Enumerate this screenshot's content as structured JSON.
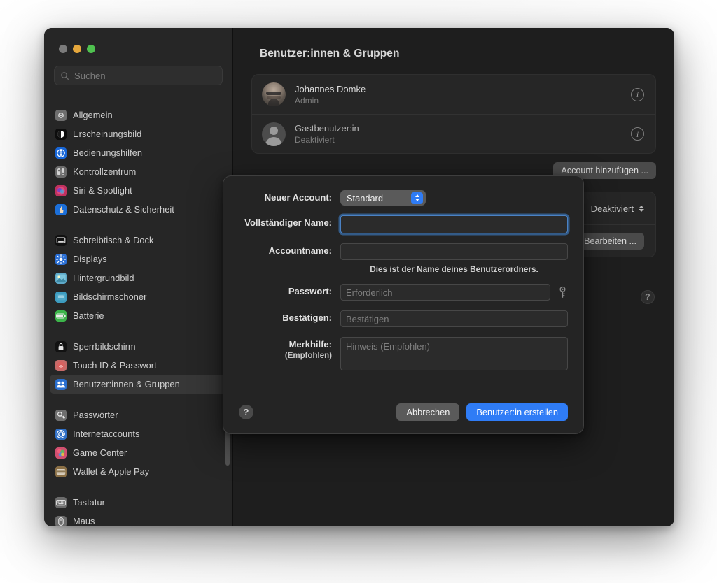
{
  "window": {
    "traffic_lights": [
      "close",
      "minimize",
      "zoom"
    ]
  },
  "sidebar": {
    "search": {
      "placeholder": "Suchen",
      "value": ""
    },
    "groups": [
      {
        "items": [
          {
            "label": "Allgemein",
            "icon": "gear-icon",
            "color": "#6e6e6e"
          },
          {
            "label": "Erscheinungsbild",
            "icon": "appearance-icon",
            "color": "#0d0d0d"
          },
          {
            "label": "Bedienungshilfen",
            "icon": "accessibility-icon",
            "color": "#1866d6"
          },
          {
            "label": "Kontrollzentrum",
            "icon": "control-center-icon",
            "color": "#6b6b6b"
          },
          {
            "label": "Siri & Spotlight",
            "icon": "siri-icon",
            "color": "#c0315f"
          },
          {
            "label": "Datenschutz & Sicherheit",
            "icon": "privacy-hand-icon",
            "color": "#1c6fd8"
          }
        ]
      },
      {
        "items": [
          {
            "label": "Schreibtisch & Dock",
            "icon": "desktop-dock-icon",
            "color": "#111111"
          },
          {
            "label": "Displays",
            "icon": "display-icon",
            "color": "#2b6fd4"
          },
          {
            "label": "Hintergrundbild",
            "icon": "wallpaper-icon",
            "color": "#5ea9c8"
          },
          {
            "label": "Bildschirmschoner",
            "icon": "screensaver-icon",
            "color": "#3c9bbf"
          },
          {
            "label": "Batterie",
            "icon": "battery-icon",
            "color": "#3cb54a"
          }
        ]
      },
      {
        "items": [
          {
            "label": "Sperrbildschirm",
            "icon": "lock-screen-icon",
            "color": "#121212"
          },
          {
            "label": "Touch ID & Passwort",
            "icon": "touch-id-icon",
            "color": "#c66a68"
          },
          {
            "label": "Benutzer:innen & Gruppen",
            "icon": "users-groups-icon",
            "color": "#2a6fd0",
            "selected": true
          }
        ]
      },
      {
        "items": [
          {
            "label": "Passwörter",
            "icon": "passwords-key-icon",
            "color": "#6f6f6f"
          },
          {
            "label": "Internetaccounts",
            "icon": "internet-accounts-icon",
            "color": "#2f6fc6"
          },
          {
            "label": "Game Center",
            "icon": "game-center-icon",
            "color": "#d14f70"
          },
          {
            "label": "Wallet & Apple Pay",
            "icon": "wallet-icon",
            "color": "#8a6f45"
          }
        ]
      },
      {
        "items": [
          {
            "label": "Tastatur",
            "icon": "keyboard-icon",
            "color": "#6b6b6b"
          },
          {
            "label": "Maus",
            "icon": "mouse-icon",
            "color": "#6b6b6b"
          }
        ]
      }
    ]
  },
  "main": {
    "title": "Benutzer:innen & Gruppen",
    "users": [
      {
        "name": "Johannes Domke",
        "role": "Admin",
        "avatar": "photo",
        "info": "i"
      },
      {
        "name": "Gastbenutzer:in",
        "role": "Deaktiviert",
        "avatar": "generic",
        "info": "i"
      }
    ],
    "add_account_button": "Account hinzufügen ...",
    "settings_rows": [
      {
        "kind": "popup",
        "value": "Deaktiviert"
      },
      {
        "kind": "button",
        "value": "Bearbeiten ..."
      }
    ],
    "help_button": "?"
  },
  "sheet": {
    "fields": {
      "new_account_label": "Neuer Account:",
      "new_account_value": "Standard",
      "full_name_label": "Vollständiger Name:",
      "full_name_value": "",
      "full_name_placeholder": "",
      "account_name_label": "Accountname:",
      "account_name_value": "",
      "account_name_placeholder": "",
      "account_name_hint": "Dies ist der Name deines Benutzerordners.",
      "password_label": "Passwort:",
      "password_placeholder": "Erforderlich",
      "confirm_label": "Bestätigen:",
      "confirm_placeholder": "Bestätigen",
      "hint_label": "Merkhilfe:",
      "hint_sublabel": "(Empfohlen)",
      "hint_placeholder": "Hinweis (Empfohlen)"
    },
    "help_button": "?",
    "cancel_button": "Abbrechen",
    "create_button": "Benutzer:in erstellen",
    "accent_color": "#2f7cf6"
  }
}
